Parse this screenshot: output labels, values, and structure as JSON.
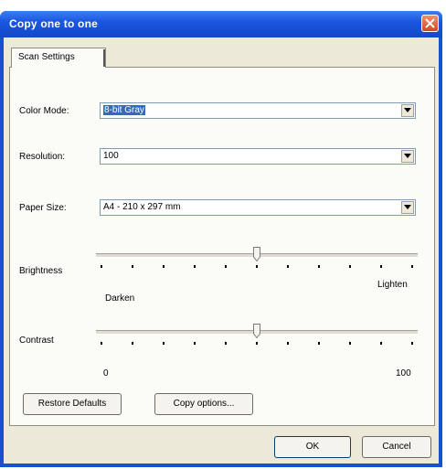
{
  "window": {
    "title": "Copy one to one"
  },
  "tabs": [
    {
      "label": "Scan Settings"
    }
  ],
  "settings": {
    "color_mode": {
      "label": "Color Mode:",
      "value": "8-bit Gray"
    },
    "resolution": {
      "label": "Resolution:",
      "value": "100"
    },
    "paper_size": {
      "label": "Paper Size:",
      "value": "A4 - 210 x 297 mm"
    }
  },
  "brightness": {
    "label": "Brightness",
    "min_label": "Darken",
    "max_label": "Lighten",
    "level": 0.5
  },
  "contrast": {
    "label": "Contrast",
    "min_label": "0",
    "max_label": "100",
    "level": 0.5
  },
  "buttons": {
    "restore_defaults": "Restore Defaults",
    "copy_options": "Copy options...",
    "ok": "OK",
    "cancel": "Cancel"
  },
  "icons": {
    "close": "close-icon",
    "dropdown": "chevron-down-icon",
    "slider_thumb": "slider-thumb"
  },
  "colors": {
    "titlebar": "#1b56df",
    "dialog_face": "#ece9d8",
    "selection": "#316ac5",
    "close_button": "#d6461f"
  }
}
